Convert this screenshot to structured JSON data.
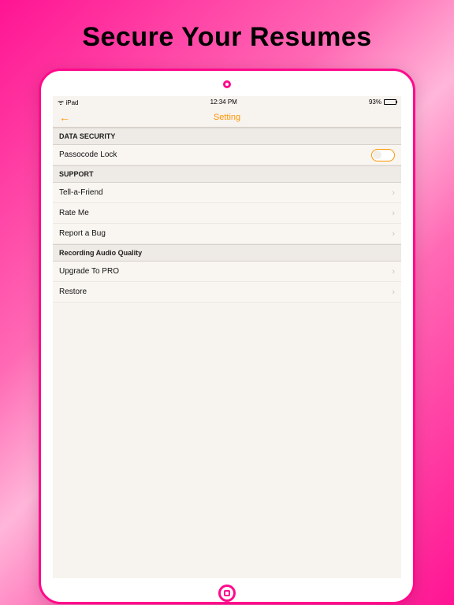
{
  "marketing": {
    "headline": "Secure Your Resumes"
  },
  "statusBar": {
    "device": "iPad",
    "time": "12:34 PM",
    "batteryPct": "93%"
  },
  "nav": {
    "title": "Setting",
    "back": "←"
  },
  "sections": {
    "dataSecurity": {
      "header": "DATA SECURITY",
      "passcode": "Passocode Lock"
    },
    "support": {
      "header": "SUPPORT",
      "tell": "Tell-a-Friend",
      "rate": "Rate Me",
      "report": "Report a Bug"
    },
    "audio": {
      "header": "Recording Audio Quality",
      "upgrade": "Upgrade To PRO",
      "restore": "Restore"
    }
  }
}
